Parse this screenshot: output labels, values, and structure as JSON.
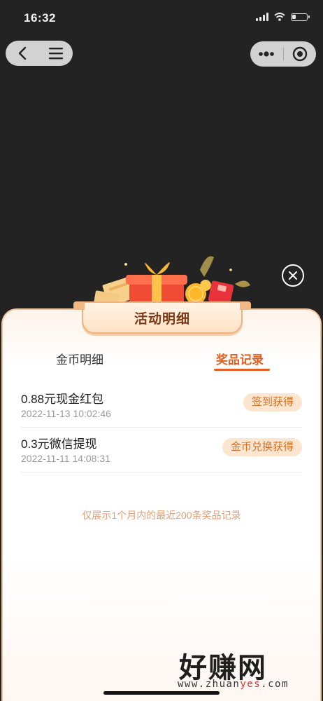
{
  "status": {
    "time": "16:32"
  },
  "icons": {
    "back": "chevron-left-icon",
    "menu": "hamburger-menu-icon",
    "more": "more-dots-icon",
    "record": "target-circle-icon",
    "close": "close-icon",
    "gift": "gift-box-icon"
  },
  "modal": {
    "title": "活动明细",
    "tabs": [
      {
        "label": "金币明细",
        "active": false
      },
      {
        "label": "奖品记录",
        "active": true
      }
    ],
    "records": [
      {
        "name": "0.88元现金红包",
        "time": "2022-11-13 10:02:46",
        "source": "签到获得"
      },
      {
        "name": "0.3元微信提现",
        "time": "2022-11-11 14:08:31",
        "source": "金币兑换获得"
      }
    ],
    "note": "仅展示1个月内的最近200条奖品记录"
  },
  "watermark": {
    "brand": "好赚网",
    "url_prefix": "www.zhuan",
    "url_highlight": "yes",
    "url_suffix": ".com"
  },
  "colors": {
    "accent": "#e45f1f",
    "badge_bg": "#fde6cf",
    "badge_text": "#d3712b",
    "backdrop": "#232323"
  }
}
